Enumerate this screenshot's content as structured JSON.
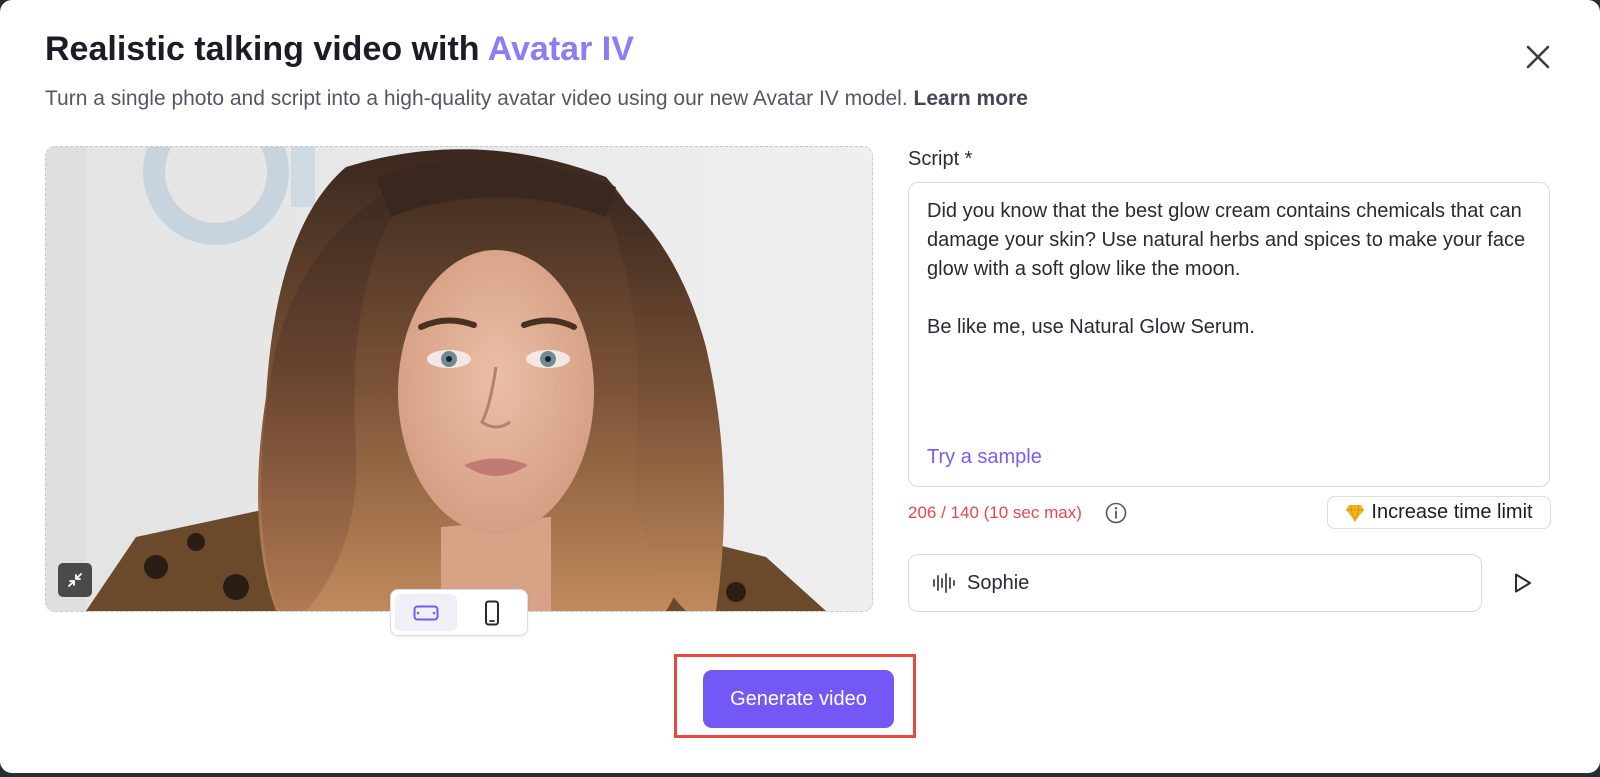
{
  "dialog": {
    "title_prefix": "Realistic talking video with ",
    "title_accent": "Avatar IV",
    "subtitle": "Turn a single photo and script into a high-quality avatar video using our new Avatar IV model. ",
    "learn_more": "Learn more",
    "close_icon": "close-icon"
  },
  "photo": {
    "alt": "Uploaded portrait photo",
    "orientation": {
      "selected": "landscape",
      "options": [
        "landscape",
        "portrait"
      ]
    }
  },
  "script": {
    "label": "Script *",
    "text": "Did you know that the best glow cream contains chemicals that can damage your skin? Use natural herbs and spices to make your face glow with a soft glow like the moon.\n\nBe like me, use Natural Glow Serum.",
    "try_sample": "Try a sample",
    "char_count": "206 / 140 (10 sec max)",
    "increase_limit": "Increase time limit",
    "warning_color": "#e5484d"
  },
  "voice": {
    "name": "Sophie",
    "icon": "waveform-icon"
  },
  "actions": {
    "generate": "Generate video",
    "accent_color": "#7458f5"
  }
}
